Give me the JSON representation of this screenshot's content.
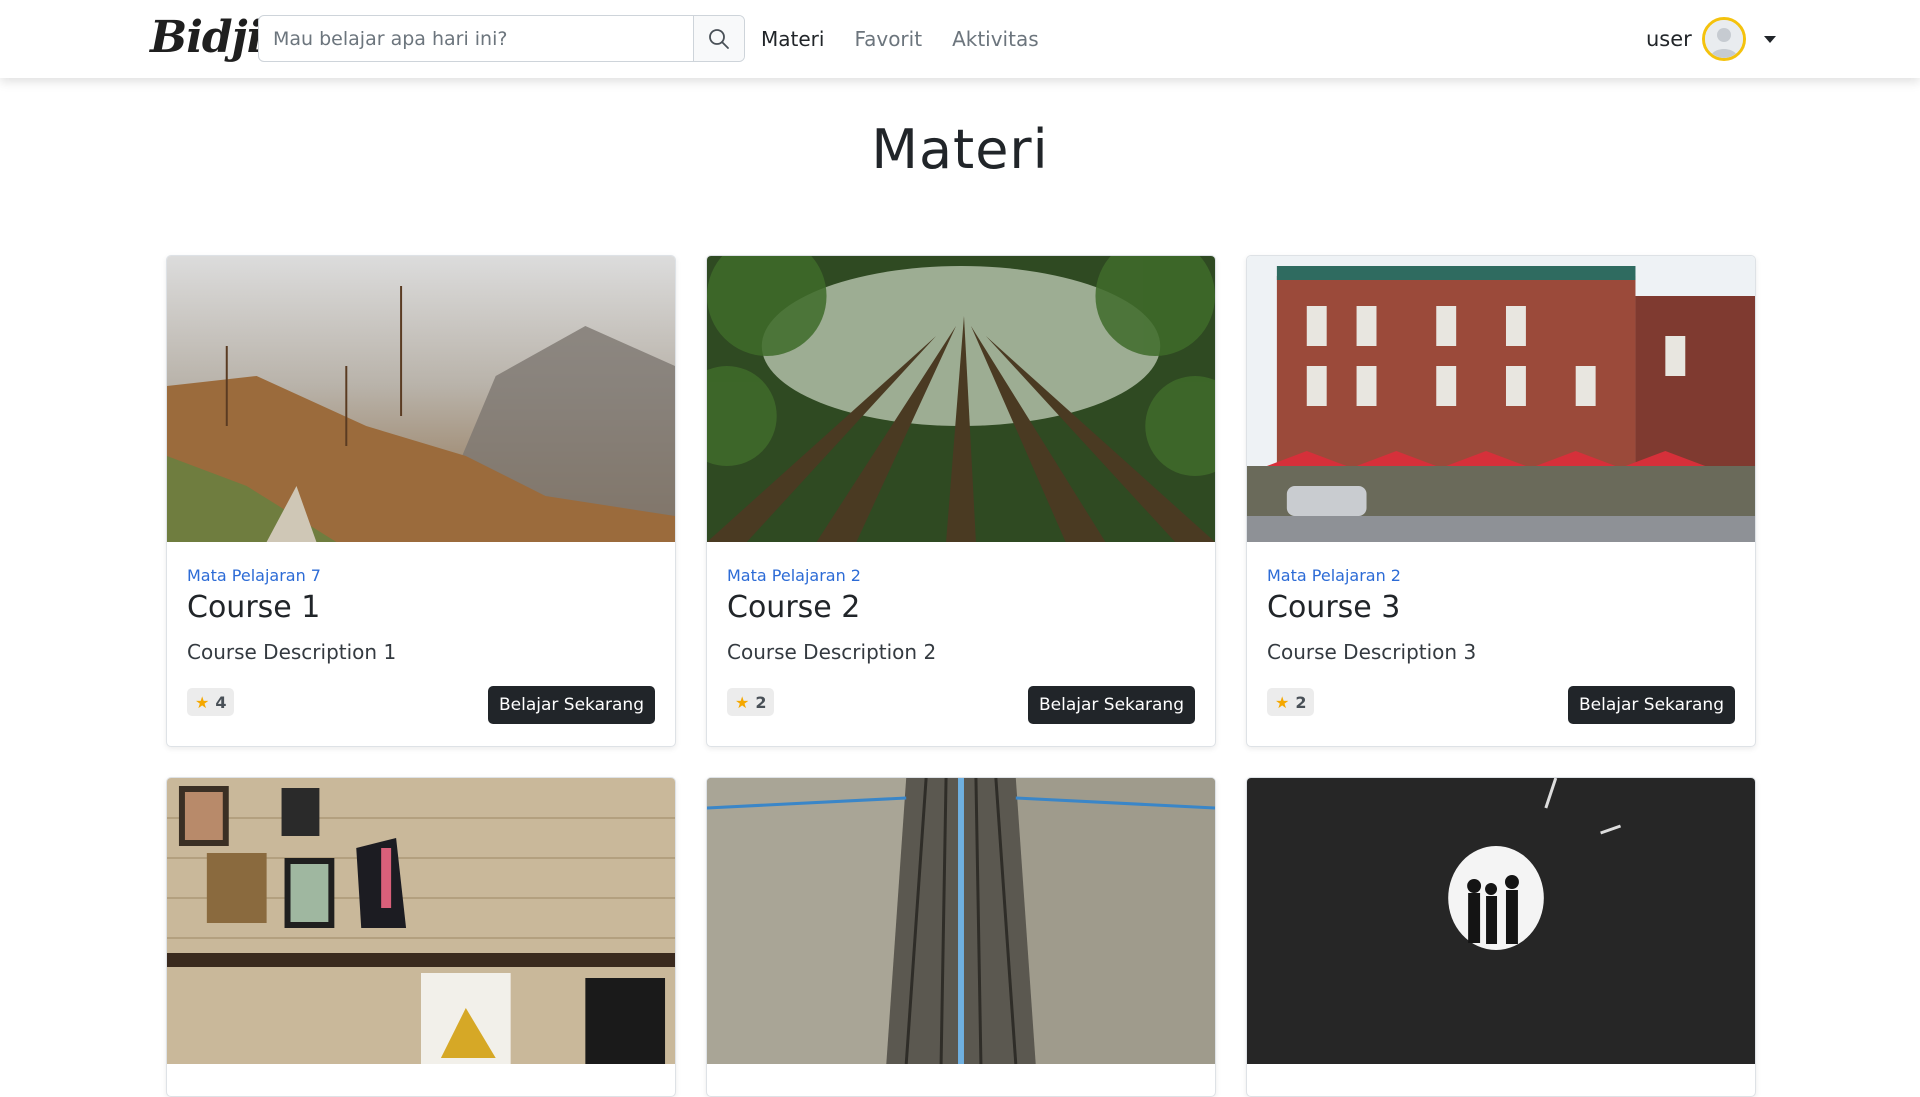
{
  "navbar": {
    "brand": "Bidji",
    "search": {
      "placeholder": "Mau belajar apa hari ini?",
      "value": "",
      "icon": "search-icon"
    },
    "links": [
      {
        "label": "Materi",
        "active": true
      },
      {
        "label": "Favorit",
        "active": false
      },
      {
        "label": "Aktivitas",
        "active": false
      }
    ],
    "user": {
      "name": "user",
      "avatar_icon": "user-avatar-icon",
      "avatar_border_color": "#f4c20d"
    }
  },
  "page": {
    "title": "Materi"
  },
  "cards": [
    {
      "subject": "Mata Pelajaran 7",
      "title": "Course 1",
      "description": "Course Description 1",
      "rating": "4",
      "button": "Belajar Sekarang",
      "image": "foggy-mountain-forest"
    },
    {
      "subject": "Mata Pelajaran 2",
      "title": "Course 2",
      "description": "Course Description 2",
      "rating": "2",
      "button": "Belajar Sekarang",
      "image": "tall-trees-looking-up"
    },
    {
      "subject": "Mata Pelajaran 2",
      "title": "Course 3",
      "description": "Course Description 3",
      "rating": "2",
      "button": "Belajar Sekarang",
      "image": "brick-building-cafe"
    },
    {
      "image": "clothing-shop-interior"
    },
    {
      "image": "railway-tracks"
    },
    {
      "image": "dark-tunnel-silhouettes"
    }
  ],
  "colors": {
    "accent_link": "#2c6bd6",
    "button_dark": "#212529",
    "star": "#f5a800"
  }
}
